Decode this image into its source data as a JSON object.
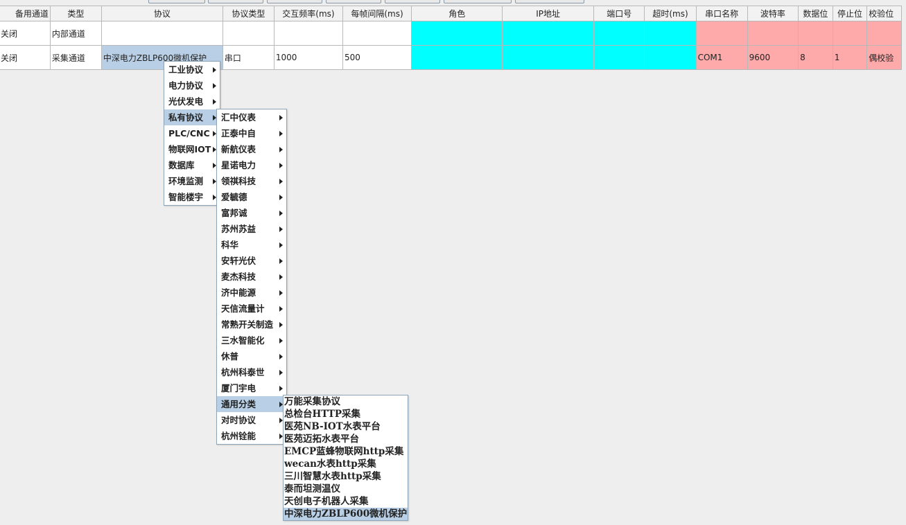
{
  "table": {
    "headers": [
      "备用通道",
      "类型",
      "协议",
      "协议类型",
      "交互频率(ms)",
      "每帧间隔(ms)",
      "角色",
      "IP地址",
      "端口号",
      "超时(ms)",
      "串口名称",
      "波特率",
      "数据位",
      "停止位",
      "校验位"
    ],
    "rows": [
      [
        "关闭",
        "内部通道",
        "",
        "",
        "",
        "",
        "",
        "",
        "",
        "",
        "",
        "",
        "",
        "",
        ""
      ],
      [
        "关闭",
        "采集通道",
        "中深电力ZBLP600微机保护",
        "串口",
        "1000",
        "500",
        "",
        "",
        "",
        "",
        "COM1",
        "9600",
        "8",
        "1",
        "偶校验"
      ]
    ]
  },
  "menu1": [
    {
      "label": "工业协议",
      "submenu": true
    },
    {
      "label": "电力协议",
      "submenu": true
    },
    {
      "label": "光伏发电",
      "submenu": true
    },
    {
      "label": "私有协议",
      "submenu": true,
      "active": true
    },
    {
      "label": "PLC/CNC",
      "submenu": true
    },
    {
      "label": "物联网IOT",
      "submenu": true
    },
    {
      "label": "数据库",
      "submenu": true
    },
    {
      "label": "环境监测",
      "submenu": true
    },
    {
      "label": "智能楼宇",
      "submenu": true
    }
  ],
  "menu2": [
    {
      "label": "汇中仪表",
      "submenu": true
    },
    {
      "label": "正泰中自",
      "submenu": true
    },
    {
      "label": "新航仪表",
      "submenu": true
    },
    {
      "label": "星诺电力",
      "submenu": true
    },
    {
      "label": "领祺科技",
      "submenu": true
    },
    {
      "label": "爱毓德",
      "submenu": true
    },
    {
      "label": "富邦诚",
      "submenu": true
    },
    {
      "label": "苏州苏益",
      "submenu": true
    },
    {
      "label": "科华",
      "submenu": true
    },
    {
      "label": "安轩光伏",
      "submenu": true
    },
    {
      "label": "麦杰科技",
      "submenu": true
    },
    {
      "label": "济中能源",
      "submenu": true
    },
    {
      "label": "天信流量计",
      "submenu": true
    },
    {
      "label": "常熟开关制造",
      "submenu": true
    },
    {
      "label": "三水智能化",
      "submenu": true
    },
    {
      "label": "休普",
      "submenu": true
    },
    {
      "label": "杭州科泰世",
      "submenu": true
    },
    {
      "label": "厦门宇电",
      "submenu": true
    },
    {
      "label": "通用分类",
      "submenu": true,
      "active": true
    },
    {
      "label": "对时协议",
      "submenu": true
    },
    {
      "label": "杭州铨能",
      "submenu": true
    }
  ],
  "menu3": [
    {
      "label": "万能采集协议"
    },
    {
      "label": "总检台HTTP采集"
    },
    {
      "label": "医苑NB-IOT水表平台"
    },
    {
      "label": "医苑迈拓水表平台"
    },
    {
      "label": "EMCP蓝蜂物联网http采集"
    },
    {
      "label": "wecan水表http采集"
    },
    {
      "label": "三川智慧水表http采集"
    },
    {
      "label": "泰而坦测温仪"
    },
    {
      "label": "天创电子机器人采集"
    },
    {
      "label": "中深电力ZBLP600微机保护",
      "active": true
    }
  ],
  "colors": {
    "cyan_cells": "#00ffff",
    "pink_cells": "#ffaaaa",
    "selection": "#b8cfe5",
    "menu_border": "#8da3b8"
  }
}
